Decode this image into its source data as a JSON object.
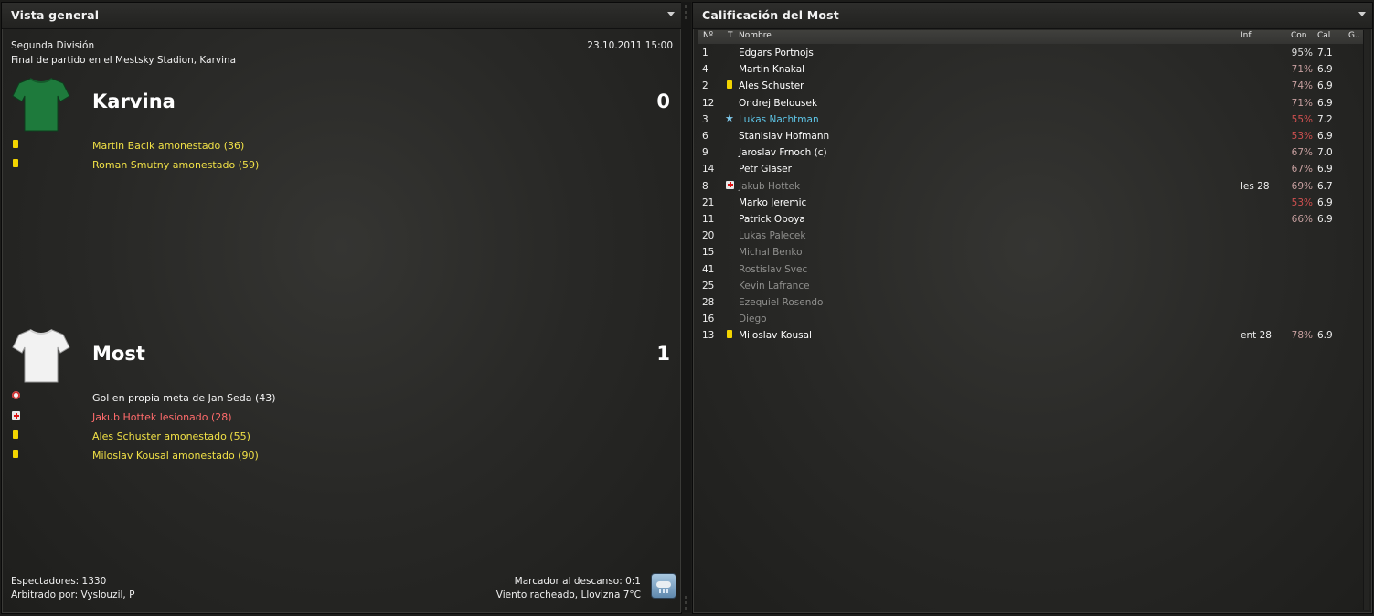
{
  "overview": {
    "title": "Vista general",
    "competition": "Segunda División",
    "datetime": "23.10.2011 15:00",
    "venue": "Final de partido en el Mestsky Stadion, Karvina",
    "home": {
      "name": "Karvina",
      "score": "0",
      "shirt_color": "#1e7a3c",
      "events": [
        {
          "type": "yellow-card",
          "text": "Martin Bacik amonestado (36)"
        },
        {
          "type": "yellow-card",
          "text": "Roman Smutny amonestado (59)"
        }
      ]
    },
    "away": {
      "name": "Most",
      "score": "1",
      "shirt_color": "#f2f2f2",
      "events": [
        {
          "type": "goal",
          "text": "Gol en propia meta de Jan Seda (43)"
        },
        {
          "type": "injury",
          "text": "Jakub Hottek lesionado (28)"
        },
        {
          "type": "yellow-card",
          "text": "Ales Schuster amonestado (55)"
        },
        {
          "type": "yellow-card",
          "text": "Miloslav Kousal amonestado (90)"
        }
      ]
    },
    "attendance": "Espectadores: 1330",
    "referee": "Arbitrado por: Vyslouzil, P",
    "halftime": "Marcador al descanso: 0:1",
    "weather": "Viento racheado, Llovizna 7°C",
    "weather_icon": "rain-cloud-icon"
  },
  "ratings": {
    "title": "Calificación del Most",
    "columns": {
      "num": "Nº",
      "t": "T",
      "name": "Nombre",
      "inf": "Inf.",
      "con": "Con",
      "cal": "Cal",
      "g": "G.."
    },
    "rows": [
      {
        "num": "1",
        "icon": "",
        "name": "Edgars Portnojs",
        "inf": "",
        "con": "95%",
        "cal": "7.1",
        "state": "active",
        "con_level": "ok"
      },
      {
        "num": "4",
        "icon": "",
        "name": "Martin Knakal",
        "inf": "",
        "con": "71%",
        "cal": "6.9",
        "state": "active",
        "con_level": "mid"
      },
      {
        "num": "2",
        "icon": "yellow-card",
        "name": "Ales Schuster",
        "inf": "",
        "con": "74%",
        "cal": "6.9",
        "state": "active",
        "con_level": "mid"
      },
      {
        "num": "12",
        "icon": "",
        "name": "Ondrej Belousek",
        "inf": "",
        "con": "71%",
        "cal": "6.9",
        "state": "active",
        "con_level": "mid"
      },
      {
        "num": "3",
        "icon": "star",
        "name": "Lukas Nachtman",
        "inf": "",
        "con": "55%",
        "cal": "7.2",
        "state": "star",
        "con_level": "low"
      },
      {
        "num": "6",
        "icon": "",
        "name": "Stanislav Hofmann",
        "inf": "",
        "con": "53%",
        "cal": "6.9",
        "state": "active",
        "con_level": "low"
      },
      {
        "num": "9",
        "icon": "",
        "name": "Jaroslav Frnoch (c)",
        "inf": "",
        "con": "67%",
        "cal": "7.0",
        "state": "active",
        "con_level": "mid"
      },
      {
        "num": "14",
        "icon": "",
        "name": "Petr Glaser",
        "inf": "",
        "con": "67%",
        "cal": "6.9",
        "state": "active",
        "con_level": "mid"
      },
      {
        "num": "8",
        "icon": "injury",
        "name": "Jakub Hottek",
        "inf": "les 28",
        "con": "69%",
        "cal": "6.7",
        "state": "bench",
        "con_level": "mid"
      },
      {
        "num": "21",
        "icon": "",
        "name": "Marko Jeremic",
        "inf": "",
        "con": "53%",
        "cal": "6.9",
        "state": "active",
        "con_level": "low"
      },
      {
        "num": "11",
        "icon": "",
        "name": "Patrick Oboya",
        "inf": "",
        "con": "66%",
        "cal": "6.9",
        "state": "active",
        "con_level": "mid"
      },
      {
        "num": "20",
        "icon": "",
        "name": "Lukas Palecek",
        "inf": "",
        "con": "",
        "cal": "",
        "state": "bench",
        "con_level": ""
      },
      {
        "num": "15",
        "icon": "",
        "name": "Michal Benko",
        "inf": "",
        "con": "",
        "cal": "",
        "state": "bench",
        "con_level": ""
      },
      {
        "num": "41",
        "icon": "",
        "name": "Rostislav Svec",
        "inf": "",
        "con": "",
        "cal": "",
        "state": "bench",
        "con_level": ""
      },
      {
        "num": "25",
        "icon": "",
        "name": "Kevin Lafrance",
        "inf": "",
        "con": "",
        "cal": "",
        "state": "bench",
        "con_level": ""
      },
      {
        "num": "28",
        "icon": "",
        "name": "Ezequiel Rosendo",
        "inf": "",
        "con": "",
        "cal": "",
        "state": "bench",
        "con_level": ""
      },
      {
        "num": "16",
        "icon": "",
        "name": "Diego",
        "inf": "",
        "con": "",
        "cal": "",
        "state": "bench",
        "con_level": ""
      },
      {
        "num": "13",
        "icon": "yellow-card",
        "name": "Miloslav Kousal",
        "inf": "ent 28",
        "con": "78%",
        "cal": "6.9",
        "state": "active",
        "con_level": "mid"
      }
    ]
  }
}
